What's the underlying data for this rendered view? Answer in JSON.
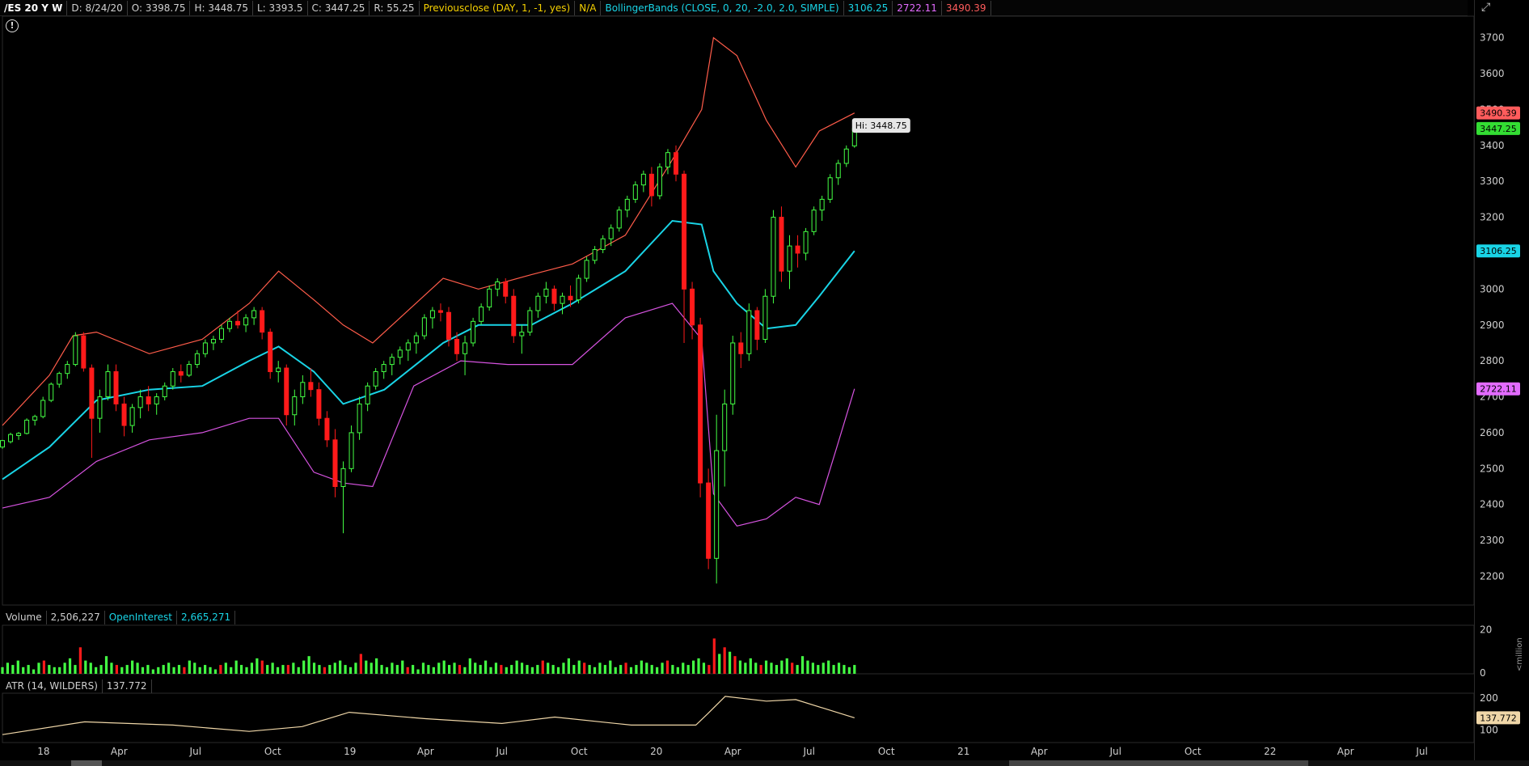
{
  "header": {
    "symbol": "/ES 20 Y W",
    "date": "D: 8/24/20",
    "open": "O: 3398.75",
    "high": "H: 3448.75",
    "low": "L: 3393.5",
    "close": "C: 3447.25",
    "range": "R: 55.25",
    "prev_close_study": "Previousclose (DAY, 1, -1, yes)",
    "prev_close_value": "N/A",
    "bb_study": "BollingerBands (CLOSE, 0, 20, -2.0, 2.0, SIMPLE)",
    "bb_mid": "3106.25",
    "bb_lower": "2722.11",
    "bb_upper": "3490.39"
  },
  "volume_pane": {
    "label": "Volume",
    "value": "2,506,227",
    "oi_label": "OpenInterest",
    "oi_value": "2,665,271",
    "unit_label": "<million",
    "ticks": [
      "20",
      "0"
    ]
  },
  "atr_pane": {
    "label": "ATR (14, WILDERS)",
    "value": "137.772",
    "ticks": [
      "200",
      "100"
    ]
  },
  "colors": {
    "up": "#44ff44",
    "down": "#ff1a1a",
    "bb_mid": "#19d4e6",
    "bb_upper": "#ff5c4a",
    "bb_lower": "#d653e0",
    "atr": "#f0d7a8",
    "grid": "#222222"
  },
  "icons": {
    "info": "info-icon",
    "chart_tools": "expand-icon"
  },
  "chart_data": {
    "type": "candlestick",
    "x_tick_labels": [
      "18",
      "Apr",
      "Jul",
      "Oct",
      "19",
      "Apr",
      "Jul",
      "Oct",
      "20",
      "Apr",
      "Jul",
      "Oct",
      "21",
      "Apr",
      "Jul",
      "Oct",
      "22",
      "Apr",
      "Jul"
    ],
    "x_tick_dates": [
      "2018-01-01",
      "2018-04-01",
      "2018-07-01",
      "2018-10-01",
      "2019-01-01",
      "2019-04-01",
      "2019-07-01",
      "2019-10-01",
      "2020-01-01",
      "2020-04-01",
      "2020-07-01",
      "2020-10-01",
      "2021-01-01",
      "2021-04-01",
      "2021-07-01",
      "2021-10-01",
      "2022-01-01",
      "2022-04-01",
      "2022-07-01"
    ],
    "y_ticks": [
      2200,
      2300,
      2400,
      2500,
      2600,
      2700,
      2800,
      2900,
      3000,
      3100,
      3200,
      3300,
      3400,
      3500,
      3600,
      3700
    ],
    "ylim": [
      2120,
      3760
    ],
    "price_tags": [
      {
        "value": 3490.39,
        "label": "3490.39",
        "color": "#ff5c5c"
      },
      {
        "value": 3447.25,
        "label": "3447.25",
        "color": "#33dd33"
      },
      {
        "value": 3106.25,
        "label": "3106.25",
        "color": "#19d4e6"
      },
      {
        "value": 2722.11,
        "label": "2722.11",
        "color": "#e36bff"
      }
    ],
    "hi_annotation": {
      "text": "Hi: 3448.75",
      "value": 3448.75
    },
    "atr_tag": {
      "value": 137.772,
      "label": "137.772"
    },
    "close_series": {
      "dates": [
        "2017-11-13",
        "2017-12-11",
        "2018-01-08",
        "2018-01-22",
        "2018-02-05",
        "2018-03-05",
        "2018-04-02",
        "2018-05-07",
        "2018-06-11",
        "2018-07-09",
        "2018-08-06",
        "2018-09-03",
        "2018-09-24",
        "2018-10-08",
        "2018-10-29",
        "2018-11-19",
        "2018-12-10",
        "2018-12-24",
        "2019-01-14",
        "2019-02-11",
        "2019-03-18",
        "2019-04-22",
        "2019-05-13",
        "2019-06-03",
        "2019-07-08",
        "2019-08-05",
        "2019-08-26",
        "2019-09-23",
        "2019-10-21",
        "2019-11-25",
        "2019-12-23",
        "2020-01-20",
        "2020-02-17",
        "2020-03-02",
        "2020-03-16",
        "2020-03-23",
        "2020-04-13",
        "2020-05-11",
        "2020-06-08",
        "2020-06-22",
        "2020-07-13",
        "2020-08-03",
        "2020-08-24"
      ],
      "values": [
        2580,
        2640,
        2740,
        2850,
        2630,
        2680,
        2670,
        2710,
        2780,
        2800,
        2850,
        2900,
        2920,
        2770,
        2710,
        2660,
        2480,
        2420,
        2640,
        2760,
        2820,
        2920,
        2830,
        2830,
        2990,
        2850,
        2900,
        2980,
        3020,
        3140,
        3230,
        3330,
        3390,
        3000,
        2620,
        2230,
        2800,
        2930,
        3150,
        3010,
        3220,
        3330,
        3447.25
      ]
    },
    "bb_mid_series": {
      "dates": [
        "2017-11-13",
        "2018-01-08",
        "2018-03-05",
        "2018-05-07",
        "2018-07-09",
        "2018-09-03",
        "2018-10-08",
        "2018-11-19",
        "2018-12-24",
        "2019-02-11",
        "2019-04-22",
        "2019-06-03",
        "2019-08-05",
        "2019-09-23",
        "2019-11-25",
        "2020-01-20",
        "2020-02-24",
        "2020-03-09",
        "2020-04-06",
        "2020-05-11",
        "2020-06-15",
        "2020-07-13",
        "2020-08-24"
      ],
      "values": [
        2470,
        2560,
        2690,
        2720,
        2730,
        2800,
        2840,
        2770,
        2680,
        2720,
        2850,
        2900,
        2900,
        2960,
        3050,
        3190,
        3180,
        3050,
        2960,
        2890,
        2900,
        2980,
        3106.25
      ]
    },
    "bb_upper_series": {
      "dates": [
        "2017-11-13",
        "2018-01-08",
        "2018-02-05",
        "2018-03-05",
        "2018-05-07",
        "2018-07-09",
        "2018-09-03",
        "2018-10-08",
        "2018-11-19",
        "2018-12-24",
        "2019-01-28",
        "2019-04-22",
        "2019-06-03",
        "2019-08-05",
        "2019-09-23",
        "2019-11-25",
        "2020-01-20",
        "2020-02-24",
        "2020-03-09",
        "2020-04-06",
        "2020-05-11",
        "2020-06-15",
        "2020-07-13",
        "2020-08-24"
      ],
      "values": [
        2620,
        2760,
        2870,
        2880,
        2820,
        2860,
        2960,
        3050,
        2970,
        2900,
        2850,
        3030,
        3000,
        3040,
        3070,
        3150,
        3360,
        3500,
        3700,
        3650,
        3470,
        3340,
        3440,
        3490.39
      ]
    },
    "bb_lower_series": {
      "dates": [
        "2017-11-13",
        "2018-01-08",
        "2018-03-05",
        "2018-05-07",
        "2018-07-09",
        "2018-09-03",
        "2018-10-08",
        "2018-11-19",
        "2018-12-24",
        "2019-01-28",
        "2019-03-18",
        "2019-05-13",
        "2019-07-08",
        "2019-09-23",
        "2019-11-25",
        "2020-01-20",
        "2020-02-24",
        "2020-03-09",
        "2020-04-06",
        "2020-05-11",
        "2020-06-15",
        "2020-07-13",
        "2020-08-03",
        "2020-08-24"
      ],
      "values": [
        2390,
        2420,
        2520,
        2580,
        2600,
        2640,
        2640,
        2490,
        2460,
        2450,
        2730,
        2800,
        2790,
        2790,
        2920,
        2960,
        2860,
        2430,
        2340,
        2360,
        2420,
        2400,
        2560,
        2722.11
      ]
    },
    "atr_series": {
      "dates": [
        "2017-11-13",
        "2018-02-19",
        "2018-06-04",
        "2018-09-03",
        "2018-11-05",
        "2018-12-31",
        "2019-04-01",
        "2019-07-01",
        "2019-09-02",
        "2019-12-02",
        "2020-02-17",
        "2020-03-02",
        "2020-03-23",
        "2020-05-11",
        "2020-06-15",
        "2020-08-24"
      ],
      "values": [
        85,
        125,
        115,
        95,
        110,
        155,
        135,
        120,
        140,
        115,
        115,
        150,
        205,
        190,
        195,
        137.772
      ]
    },
    "volume_series": {
      "values": [
        3,
        5,
        4,
        6,
        3,
        4,
        2,
        5,
        6,
        4,
        3,
        3,
        5,
        7,
        4,
        12,
        6,
        5,
        3,
        4,
        8,
        5,
        4,
        3,
        4,
        6,
        5,
        3,
        4,
        2,
        3,
        4,
        5,
        3,
        4,
        3,
        6,
        5,
        3,
        4,
        3,
        2,
        4,
        5,
        3,
        6,
        4,
        3,
        5,
        7,
        6,
        4,
        5,
        3,
        4,
        4,
        5,
        3,
        6,
        8,
        5,
        4,
        3,
        4,
        5,
        6,
        4,
        3,
        5,
        9,
        6,
        5,
        7,
        4,
        3,
        5,
        4,
        6,
        3,
        4,
        2,
        5,
        4,
        3,
        5,
        6,
        4,
        5,
        4,
        3,
        7,
        5,
        4,
        6,
        3,
        5,
        4,
        3,
        4,
        6,
        5,
        4,
        3,
        4,
        6,
        5,
        4,
        3,
        5,
        7,
        4,
        6,
        5,
        4,
        3,
        5,
        4,
        6,
        3,
        4,
        5,
        3,
        4,
        6,
        5,
        4,
        3,
        5,
        6,
        4,
        3,
        5,
        4,
        6,
        7,
        5,
        4,
        16,
        9,
        12,
        10,
        8,
        6,
        5,
        7,
        5,
        4,
        6,
        5,
        4,
        6,
        7,
        5,
        4,
        8,
        6,
        5,
        4,
        5,
        6,
        4,
        5,
        4,
        3,
        4
      ],
      "down_indices": [
        8,
        15,
        22,
        35,
        42,
        50,
        55,
        62,
        69,
        78,
        88,
        96,
        104,
        112,
        120,
        128,
        136,
        137,
        139,
        141,
        146,
        152
      ]
    },
    "candles": [
      [
        2560,
        2580,
        2555,
        2578
      ],
      [
        2575,
        2600,
        2570,
        2595
      ],
      [
        2592,
        2602,
        2580,
        2598
      ],
      [
        2598,
        2640,
        2595,
        2635
      ],
      [
        2635,
        2650,
        2620,
        2645
      ],
      [
        2645,
        2700,
        2640,
        2690
      ],
      [
        2690,
        2740,
        2685,
        2735
      ],
      [
        2735,
        2770,
        2725,
        2765
      ],
      [
        2765,
        2800,
        2750,
        2790
      ],
      [
        2790,
        2880,
        2785,
        2870
      ],
      [
        2870,
        2880,
        2770,
        2780
      ],
      [
        2780,
        2790,
        2530,
        2640
      ],
      [
        2640,
        2720,
        2600,
        2700
      ],
      [
        2700,
        2790,
        2690,
        2770
      ],
      [
        2770,
        2790,
        2660,
        2680
      ],
      [
        2680,
        2700,
        2590,
        2620
      ],
      [
        2620,
        2680,
        2600,
        2670
      ],
      [
        2670,
        2720,
        2640,
        2700
      ],
      [
        2700,
        2730,
        2660,
        2680
      ],
      [
        2680,
        2710,
        2650,
        2700
      ],
      [
        2700,
        2740,
        2690,
        2730
      ],
      [
        2730,
        2780,
        2720,
        2770
      ],
      [
        2770,
        2790,
        2740,
        2760
      ],
      [
        2760,
        2800,
        2755,
        2790
      ],
      [
        2790,
        2830,
        2780,
        2820
      ],
      [
        2820,
        2860,
        2810,
        2850
      ],
      [
        2850,
        2870,
        2830,
        2860
      ],
      [
        2860,
        2900,
        2850,
        2890
      ],
      [
        2890,
        2920,
        2880,
        2910
      ],
      [
        2910,
        2940,
        2890,
        2900
      ],
      [
        2900,
        2930,
        2880,
        2920
      ],
      [
        2920,
        2950,
        2900,
        2940
      ],
      [
        2940,
        2950,
        2860,
        2880
      ],
      [
        2880,
        2890,
        2750,
        2770
      ],
      [
        2770,
        2800,
        2740,
        2780
      ],
      [
        2780,
        2790,
        2620,
        2650
      ],
      [
        2650,
        2720,
        2620,
        2700
      ],
      [
        2700,
        2760,
        2680,
        2740
      ],
      [
        2740,
        2780,
        2700,
        2720
      ],
      [
        2720,
        2740,
        2620,
        2640
      ],
      [
        2640,
        2660,
        2560,
        2580
      ],
      [
        2580,
        2610,
        2420,
        2450
      ],
      [
        2450,
        2520,
        2320,
        2500
      ],
      [
        2500,
        2620,
        2490,
        2600
      ],
      [
        2600,
        2700,
        2580,
        2680
      ],
      [
        2680,
        2740,
        2660,
        2730
      ],
      [
        2730,
        2780,
        2720,
        2770
      ],
      [
        2770,
        2800,
        2750,
        2790
      ],
      [
        2790,
        2820,
        2760,
        2810
      ],
      [
        2810,
        2840,
        2790,
        2830
      ],
      [
        2830,
        2860,
        2800,
        2850
      ],
      [
        2850,
        2880,
        2820,
        2870
      ],
      [
        2870,
        2930,
        2860,
        2920
      ],
      [
        2920,
        2950,
        2890,
        2940
      ],
      [
        2940,
        2960,
        2910,
        2935
      ],
      [
        2935,
        2950,
        2840,
        2860
      ],
      [
        2860,
        2880,
        2800,
        2820
      ],
      [
        2820,
        2870,
        2760,
        2850
      ],
      [
        2850,
        2920,
        2840,
        2910
      ],
      [
        2910,
        2960,
        2900,
        2950
      ],
      [
        2950,
        3010,
        2940,
        3000
      ],
      [
        3000,
        3030,
        2980,
        3020
      ],
      [
        3020,
        3030,
        2960,
        2980
      ],
      [
        2980,
        3000,
        2850,
        2870
      ],
      [
        2870,
        2900,
        2820,
        2880
      ],
      [
        2880,
        2950,
        2870,
        2940
      ],
      [
        2940,
        2990,
        2920,
        2980
      ],
      [
        2980,
        3020,
        2960,
        3000
      ],
      [
        3000,
        3010,
        2940,
        2960
      ],
      [
        2960,
        2990,
        2930,
        2980
      ],
      [
        2980,
        3010,
        2950,
        2970
      ],
      [
        2970,
        3040,
        2960,
        3030
      ],
      [
        3030,
        3090,
        3020,
        3080
      ],
      [
        3080,
        3120,
        3070,
        3110
      ],
      [
        3110,
        3150,
        3100,
        3140
      ],
      [
        3140,
        3180,
        3120,
        3170
      ],
      [
        3170,
        3230,
        3160,
        3220
      ],
      [
        3220,
        3260,
        3200,
        3250
      ],
      [
        3250,
        3300,
        3240,
        3290
      ],
      [
        3290,
        3330,
        3270,
        3320
      ],
      [
        3320,
        3340,
        3230,
        3260
      ],
      [
        3260,
        3350,
        3250,
        3340
      ],
      [
        3340,
        3390,
        3320,
        3380
      ],
      [
        3380,
        3400,
        3300,
        3320
      ],
      [
        3320,
        3330,
        2850,
        3000
      ],
      [
        3000,
        3020,
        2860,
        2900
      ],
      [
        2900,
        2920,
        2420,
        2460
      ],
      [
        2460,
        2500,
        2220,
        2250
      ],
      [
        2250,
        2650,
        2180,
        2550
      ],
      [
        2550,
        2720,
        2450,
        2680
      ],
      [
        2680,
        2870,
        2650,
        2850
      ],
      [
        2850,
        2880,
        2780,
        2820
      ],
      [
        2820,
        2960,
        2800,
        2940
      ],
      [
        2940,
        2950,
        2830,
        2860
      ],
      [
        2860,
        3000,
        2850,
        2980
      ],
      [
        2980,
        3220,
        2960,
        3200
      ],
      [
        3200,
        3230,
        3020,
        3050
      ],
      [
        3050,
        3150,
        3000,
        3120
      ],
      [
        3120,
        3150,
        3060,
        3100
      ],
      [
        3100,
        3170,
        3080,
        3160
      ],
      [
        3160,
        3230,
        3150,
        3220
      ],
      [
        3220,
        3260,
        3190,
        3250
      ],
      [
        3250,
        3320,
        3240,
        3310
      ],
      [
        3310,
        3360,
        3290,
        3350
      ],
      [
        3350,
        3400,
        3340,
        3390
      ],
      [
        3398.75,
        3448.75,
        3393.5,
        3447.25
      ]
    ],
    "candle_dates_note": "weekly bars from 2017-11-13 to 2020-08-24"
  }
}
